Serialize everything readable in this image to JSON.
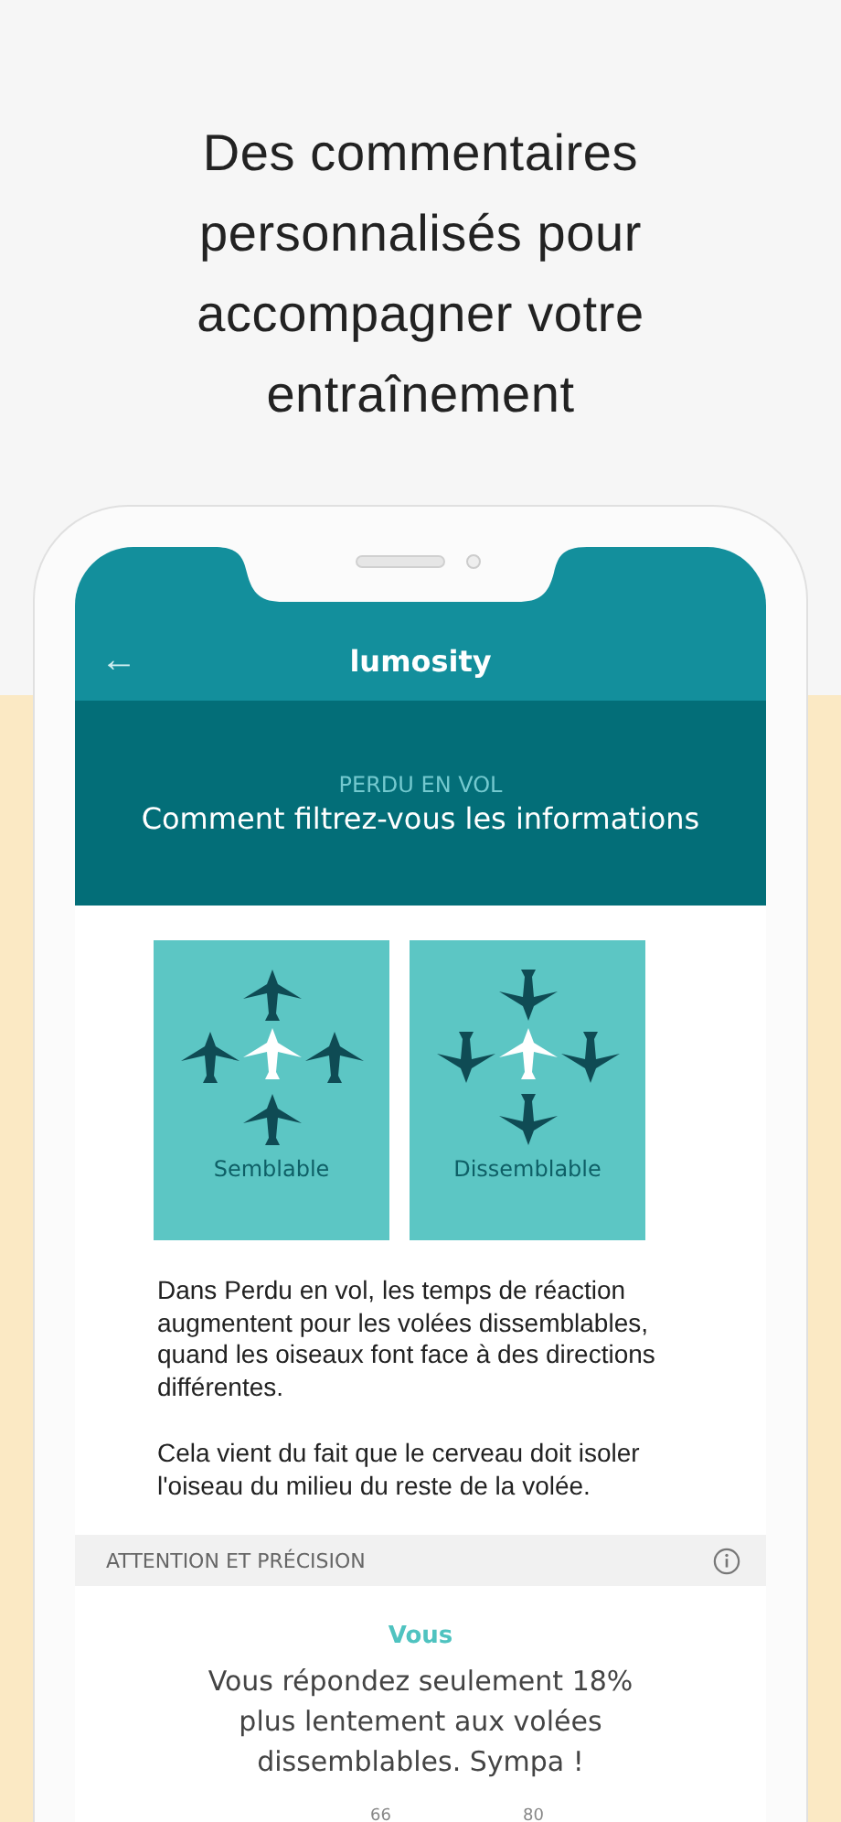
{
  "headline": {
    "lines": [
      "Des commentaires",
      "personnalisés pour",
      "accompagner votre",
      "entraînement"
    ]
  },
  "app_bar": {
    "back": "←",
    "title": "lumosity"
  },
  "banner": {
    "game": "PERDU EN VOL",
    "title": "Comment filtrez-vous les informations"
  },
  "flocks": [
    {
      "label": "Semblable",
      "kind": "same"
    },
    {
      "label": "Dissemblable",
      "kind": "opposite"
    }
  ],
  "paragraphs": [
    "Dans Perdu en vol, les temps de réaction augmentent pour les volées dissemblables, quand les oiseaux font face à des directions différentes.",
    "Cela vient du fait que le cerveau doit isoler l'oiseau du milieu du reste de la volée."
  ],
  "section": {
    "title": "ATTENTION ET PRÉCISION"
  },
  "result": {
    "who": "Vous",
    "text": "Vous répondez seulement 18% plus lentement aux volées dissemblables. Sympa !",
    "scale_labels": [
      "66",
      "80"
    ]
  }
}
